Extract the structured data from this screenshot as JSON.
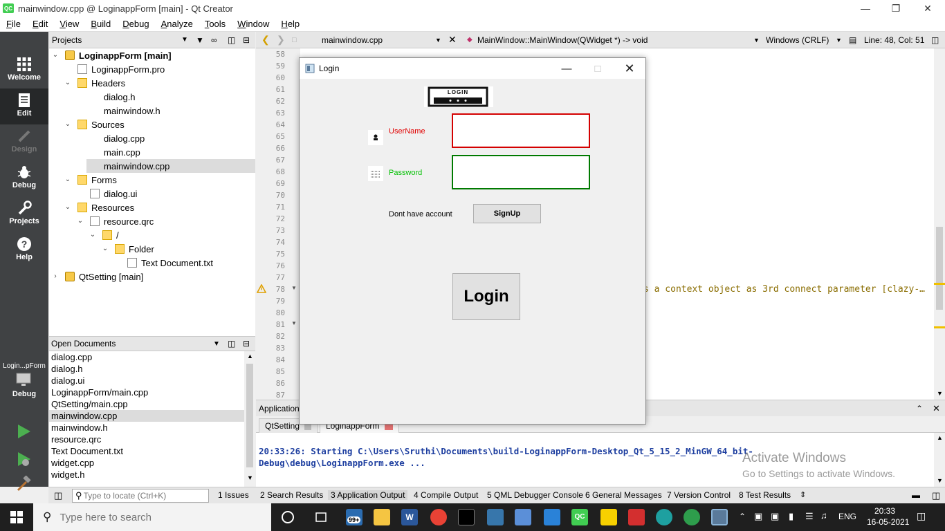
{
  "window": {
    "title": "mainwindow.cpp @ LoginappForm [main] - Qt Creator",
    "app_icon": "QC"
  },
  "menubar": {
    "items": [
      "File",
      "Edit",
      "View",
      "Build",
      "Debug",
      "Analyze",
      "Tools",
      "Window",
      "Help"
    ]
  },
  "modes": [
    "Welcome",
    "Edit",
    "Design",
    "Debug",
    "Projects",
    "Help"
  ],
  "kit": {
    "label": "Login...pForm",
    "mode": "Debug"
  },
  "projects": {
    "header": "Projects",
    "tree": [
      {
        "label": "LoginappForm [main]",
        "bold": true
      },
      {
        "label": "LoginappForm.pro"
      },
      {
        "label": "Headers"
      },
      {
        "label": "dialog.h"
      },
      {
        "label": "mainwindow.h"
      },
      {
        "label": "Sources"
      },
      {
        "label": "dialog.cpp"
      },
      {
        "label": "main.cpp"
      },
      {
        "label": "mainwindow.cpp"
      },
      {
        "label": "Forms"
      },
      {
        "label": "dialog.ui"
      },
      {
        "label": "Resources"
      },
      {
        "label": "resource.qrc"
      },
      {
        "label": "/"
      },
      {
        "label": "Folder"
      },
      {
        "label": "Text Document.txt"
      },
      {
        "label": "QtSetting [main]"
      }
    ]
  },
  "open_documents": {
    "header": "Open Documents",
    "items": [
      "dialog.cpp",
      "dialog.h",
      "dialog.ui",
      "LoginappForm/main.cpp",
      "QtSetting/main.cpp",
      "mainwindow.cpp",
      "mainwindow.h",
      "resource.qrc",
      "Text Document.txt",
      "widget.cpp",
      "widget.h"
    ],
    "selected": "mainwindow.cpp"
  },
  "editor": {
    "file": "mainwindow.cpp",
    "symbol": "MainWindow::MainWindow(QWidget *) -> void",
    "line_ending": "Windows (CRLF)",
    "position": "Line: 48, Col: 51",
    "line_numbers": [
      "58",
      "59",
      "60",
      "61",
      "62",
      "63",
      "64",
      "65",
      "66",
      "67",
      "68",
      "69",
      "70",
      "71",
      "72",
      "73",
      "74",
      "75",
      "76",
      "77",
      "78",
      "79",
      "80",
      "81",
      "82",
      "83",
      "84",
      "85",
      "86",
      "87"
    ],
    "warning_text": "s a context object as 3rd connect parameter [clazy-…"
  },
  "output": {
    "header": "Application Output",
    "tabs": [
      "QtSetting",
      "LoginappForm"
    ],
    "lines": [
      "20:33:26: Starting C:\\Users\\Sruthi\\Documents\\build-LoginappForm-Desktop_Qt_5_15_2_MinGW_64_bit-",
      "Debug\\debug\\LoginappForm.exe ..."
    ]
  },
  "watermark": {
    "line1": "Activate Windows",
    "line2": "Go to Settings to activate Windows."
  },
  "statusbar": {
    "locator_placeholder": "Type to locate (Ctrl+K)",
    "panes": [
      "1  Issues",
      "2  Search Results",
      "3  Application Output",
      "4  Compile Output",
      "5  QML Debugger Console",
      "6  General Messages",
      "7  Version Control",
      "8  Test Results"
    ]
  },
  "login_dialog": {
    "title": "Login",
    "banner_text": "LOGIN",
    "username_label": "UserName",
    "password_label": "Password",
    "username_value": "",
    "password_value": "",
    "no_account_label": "Dont have account",
    "signup_label": "SignUp",
    "login_label": "Login",
    "colors": {
      "username": "#e00000",
      "password": "#00c000",
      "username_border": "#d40000",
      "password_border": "#007a00"
    }
  },
  "taskbar": {
    "search_placeholder": "Type here to search",
    "mail_badge": "99+",
    "language": "ENG",
    "time": "20:33",
    "date": "16-05-2021"
  }
}
